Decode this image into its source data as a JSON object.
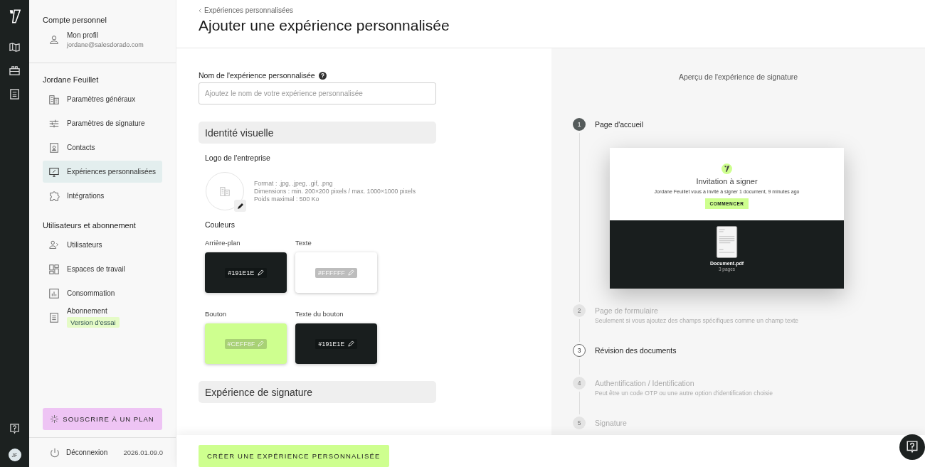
{
  "rail": {
    "icons": [
      {
        "kind": "logo"
      },
      {
        "kind": "map"
      },
      {
        "kind": "briefcase"
      },
      {
        "kind": "list"
      }
    ],
    "avatar": "JF"
  },
  "sidebar": {
    "sections": [
      {
        "title": "Compte personnel",
        "items": [
          {
            "label": "Mon profil",
            "sub": "jordane@salesdorado.com",
            "kind": "person",
            "selected": false
          }
        ]
      },
      {
        "title": "Jordane Feuillet",
        "items": [
          {
            "label": "Paramètres généraux",
            "kind": "building",
            "selected": false
          },
          {
            "label": "Paramètres de signature",
            "kind": "sliders",
            "selected": false
          },
          {
            "label": "Contacts",
            "kind": "contact",
            "selected": false
          },
          {
            "label": "Expériences personnalisées",
            "kind": "monitor",
            "selected": true
          },
          {
            "label": "Intégrations",
            "kind": "puzzle",
            "selected": false
          }
        ]
      },
      {
        "title": "Utilisateurs et abonnement",
        "items": [
          {
            "label": "Utilisateurs",
            "kind": "users",
            "selected": false
          },
          {
            "label": "Espaces de travail",
            "kind": "grid",
            "selected": false
          },
          {
            "label": "Consommation",
            "kind": "chart",
            "selected": false
          },
          {
            "label": "Abonnement",
            "kind": "doc",
            "selected": false,
            "badge": "Version d'essai"
          }
        ]
      }
    ],
    "subscribe": "SOUSCRIRE À UN PLAN",
    "logout": "Déconnexion",
    "version": "2026.01.09.0"
  },
  "header": {
    "breadcrumb": "Expériences personnalisées",
    "title": "Ajouter une expérience personnalisée"
  },
  "form": {
    "name_label": "Nom de l'expérience personnalisée",
    "name_placeholder": "Ajoutez le nom de votre expérience personnalisée",
    "identity_title": "Identité visuelle",
    "logo_title": "Logo de l'entreprise",
    "logo_hints": [
      "Format : .jpg, .jpeg, .gif, .png",
      "Dimensions : min. 200×200 pixels / max. 1000×1000 pixels",
      "Poids maximal : 500 Ko"
    ],
    "colors_title": "Couleurs",
    "swatches": [
      {
        "label": "Arrière-plan",
        "value": "#191E1E",
        "color": "#191e1e"
      },
      {
        "label": "Texte",
        "value": "#FFFFFF",
        "color": "#ffffff"
      },
      {
        "label": "Bouton",
        "value": "#CEFF8F",
        "color": "#ceff8f"
      },
      {
        "label": "Texte du bouton",
        "value": "#191E1E",
        "color": "#191e1e"
      }
    ],
    "signature_title": "Expérience de signature",
    "create_button": "CRÉER UNE EXPÉRIENCE PERSONNALISÉE"
  },
  "preview": {
    "title": "Aperçu de l'expérience de signature",
    "steps": [
      {
        "number": "1",
        "title": "Page d'accueil",
        "kind": "current"
      },
      {
        "number": "2",
        "title": "Page de formulaire",
        "sub": "Seulement si vous ajoutez des champs spécifiques comme un champ texte",
        "kind": "optional"
      },
      {
        "number": "3",
        "title": "Révision des documents",
        "kind": "included"
      },
      {
        "number": "4",
        "title": "Authentification / Identification",
        "sub": "Peut être un code OTP ou une autre option d'identification choisie",
        "kind": "optional"
      },
      {
        "number": "5",
        "title": "Signature",
        "kind": "optional"
      }
    ],
    "card": {
      "heading": "Invitation à signer",
      "message": "Jordane Feuillet vous a invité à signer 1 document, 9 minutes ago",
      "button": "COMMENCER",
      "file": "Document.pdf",
      "pages": "3 pages"
    }
  }
}
